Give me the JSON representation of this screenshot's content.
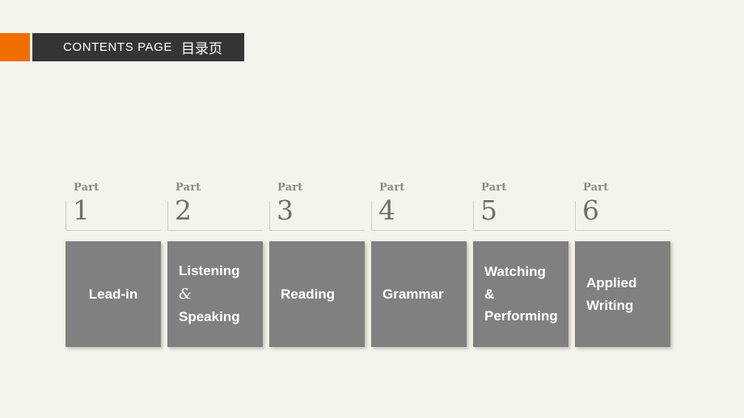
{
  "header": {
    "accent_color": "#f26d00",
    "panel_color": "#353535",
    "title_en": "CONTENTS PAGE",
    "title_cn": "目录页"
  },
  "theme": {
    "background": "#f5f4ec",
    "panel_gray": "#808080",
    "rule_color": "#cfcec4",
    "part_label_color": "#8a8a84",
    "part_number_color": "#6f6f69",
    "panel_text_color": "#ffffff"
  },
  "sections": [
    {
      "part_label": "Part",
      "part_number": "1",
      "title": "Lead-in",
      "align": "center",
      "has_ampersand": false
    },
    {
      "part_label": "Part",
      "part_number": "2",
      "title": "Listening\n&\nSpeaking",
      "line1": "Listening",
      "ampersand": "&",
      "line3": "Speaking",
      "align": "left",
      "has_ampersand": true,
      "ampersand_style": "serif"
    },
    {
      "part_label": "Part",
      "part_number": "3",
      "title": "Reading",
      "align": "left",
      "has_ampersand": false
    },
    {
      "part_label": "Part",
      "part_number": "4",
      "title": "Grammar",
      "align": "left",
      "has_ampersand": false
    },
    {
      "part_label": "Part",
      "part_number": "5",
      "title": "Watching\n&\nPerforming",
      "line1": "Watching",
      "ampersand": "&",
      "line3": "Performing",
      "align": "left",
      "has_ampersand": true,
      "ampersand_style": "sans"
    },
    {
      "part_label": "Part",
      "part_number": "6",
      "title": "Applied\nWriting",
      "align": "left",
      "has_ampersand": false
    }
  ]
}
